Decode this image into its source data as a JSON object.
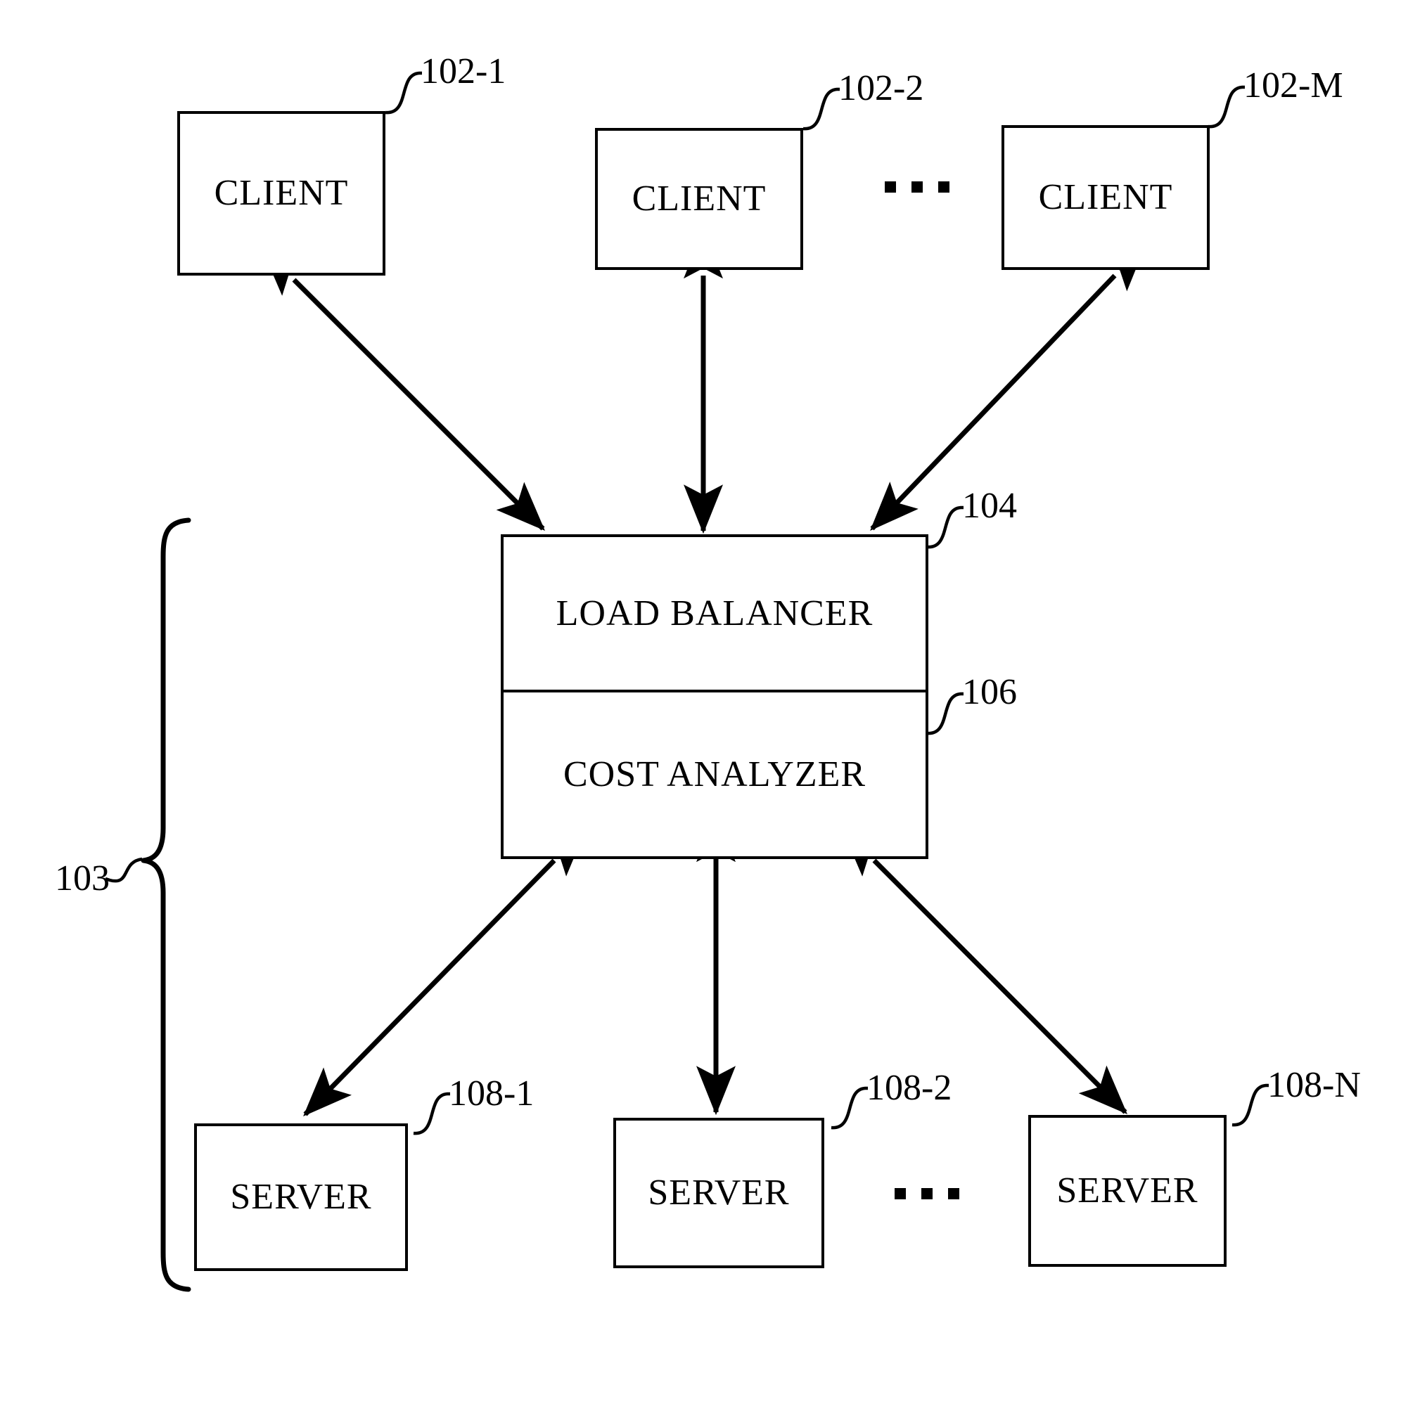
{
  "figure": {
    "background_color": "#ffffff",
    "line_color": "#000000",
    "title": ""
  },
  "clients": [
    {
      "label": "CLIENT",
      "ref": "102-1"
    },
    {
      "label": "CLIENT",
      "ref": "102-2"
    },
    {
      "label": "CLIENT",
      "ref": "102-M"
    }
  ],
  "client_ellipsis": "• • •",
  "load_balancer": {
    "ref": "104",
    "sections": [
      {
        "label": "LOAD BALANCER",
        "ref": "104"
      },
      {
        "label": "COST ANALYZER",
        "ref": "106"
      }
    ]
  },
  "servers": [
    {
      "label": "SERVER",
      "ref": "108-1"
    },
    {
      "label": "SERVER",
      "ref": "108-2"
    },
    {
      "label": "SERVER",
      "ref": "108-N"
    }
  ],
  "server_ellipsis": "• • •",
  "system_bracket": {
    "ref": "103"
  }
}
